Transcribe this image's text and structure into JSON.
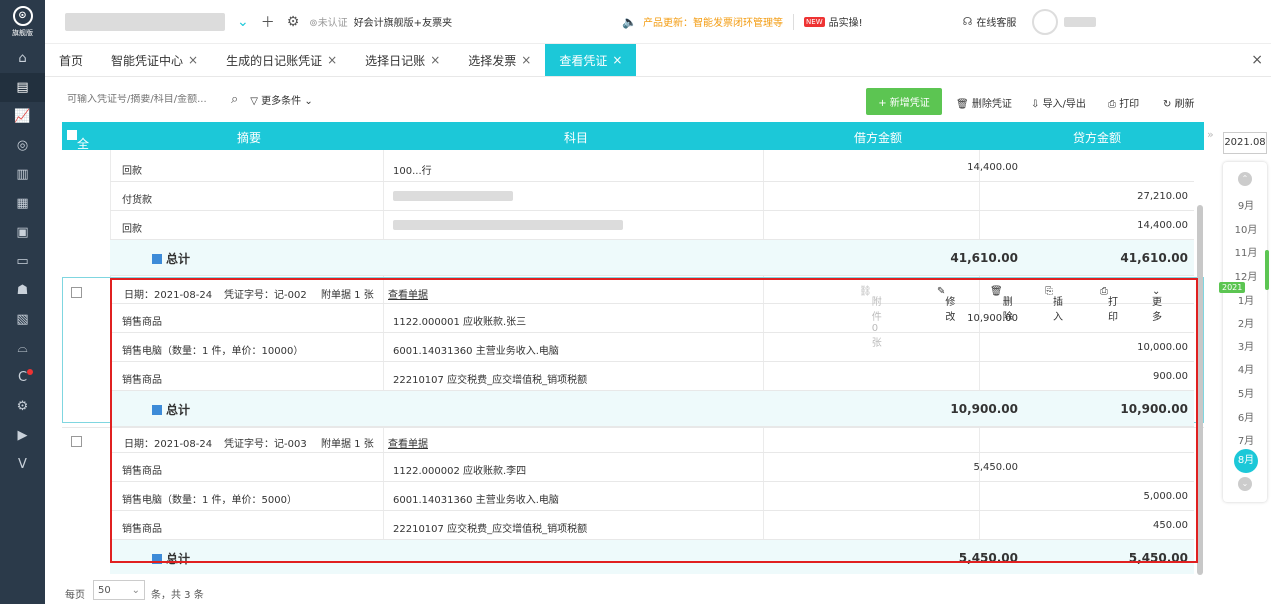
{
  "app": {
    "logo_text": "旗舰版"
  },
  "sidebar": {
    "icons": [
      "home-icon",
      "voucher-icon",
      "chart-icon",
      "money-icon",
      "ledger-icon",
      "report-icon",
      "invoice-icon",
      "asset-icon",
      "salary-icon",
      "tax-icon",
      "settings-group-icon",
      "c-app-icon",
      "gear-icon",
      "video-icon",
      "v-icon"
    ]
  },
  "topbar": {
    "auth_label": "未认证",
    "edition": "好会计旗舰版+友票夹",
    "update_label": "产品更新：智能发票闭环管理等",
    "new_badge": "NEW",
    "practice": "品实操!",
    "service": "在线客服"
  },
  "tabs": [
    {
      "label": "首页",
      "closable": false
    },
    {
      "label": "智能凭证中心",
      "closable": true
    },
    {
      "label": "生成的日记账凭证",
      "closable": true
    },
    {
      "label": "选择日记账",
      "closable": true
    },
    {
      "label": "选择发票",
      "closable": true
    },
    {
      "label": "查看凭证",
      "closable": true,
      "active": true
    }
  ],
  "toolbar": {
    "search_placeholder": "可输入凭证号/摘要/科目/金额...",
    "more_filters": "更多条件",
    "new_voucher": "+ 新增凭证",
    "delete_voucher": "删除凭证",
    "import_export": "导入/导出",
    "print": "打印",
    "refresh": "刷新"
  },
  "table": {
    "headers": {
      "select_all": "全选",
      "summary": "摘要",
      "account": "科目",
      "debit": "借方金额",
      "credit": "贷方金额"
    }
  },
  "voucher1": {
    "rows": [
      {
        "summary": "回款",
        "account": "100...行",
        "debit": "14,400.00",
        "credit": ""
      },
      {
        "summary": "付货款",
        "account": "",
        "debit": "",
        "credit": "27,210.00"
      },
      {
        "summary": "回款",
        "account": "",
        "debit": "",
        "credit": "14,400.00"
      }
    ],
    "total_label": "总计",
    "total_debit": "41,610.00",
    "total_credit": "41,610.00"
  },
  "voucher2": {
    "date": "日期：2021-08-24",
    "number": "凭证字号：记-002",
    "attach": "附单据 1 张",
    "view": "查看单据",
    "attachments": "附件 0 张",
    "edit": "修改",
    "delete": "删除",
    "insert": "插入",
    "print": "打印",
    "more": "更多",
    "rows": [
      {
        "summary": "销售商品",
        "account": "1122.000001 应收账款.张三",
        "debit": "10,900.00",
        "credit": ""
      },
      {
        "summary": "销售电脑（数量：1 件，单价：10000）",
        "account": "6001.14031360 主营业务收入.电脑",
        "debit": "",
        "credit": "10,000.00"
      },
      {
        "summary": "销售商品",
        "account": "22210107 应交税费_应交增值税_销项税额",
        "debit": "",
        "credit": "900.00"
      }
    ],
    "total_label": "总计",
    "total_debit": "10,900.00",
    "total_credit": "10,900.00"
  },
  "voucher3": {
    "date": "日期：2021-08-24",
    "number": "凭证字号：记-003",
    "attach": "附单据 1 张",
    "view": "查看单据",
    "rows": [
      {
        "summary": "销售商品",
        "account": "1122.000002 应收账款.李四",
        "debit": "5,450.00",
        "credit": ""
      },
      {
        "summary": "销售电脑（数量：1 件，单价：5000）",
        "account": "6001.14031360 主营业务收入.电脑",
        "debit": "",
        "credit": "5,000.00"
      },
      {
        "summary": "销售商品",
        "account": "22210107 应交税费_应交增值税_销项税额",
        "debit": "",
        "credit": "450.00"
      }
    ],
    "total_label": "总计",
    "total_debit": "5,450.00",
    "total_credit": "5,450.00"
  },
  "footer": {
    "per_page_label": "每页",
    "per_page": "50",
    "count_text": "条，共 3 条"
  },
  "period": {
    "current": "2021.08",
    "months_prev": [
      "9月",
      "10月",
      "11月",
      "12月"
    ],
    "year_badge": "2021",
    "months": [
      "1月",
      "2月",
      "3月",
      "4月",
      "5月",
      "6月",
      "7月",
      "8月"
    ],
    "selected": "8月"
  }
}
